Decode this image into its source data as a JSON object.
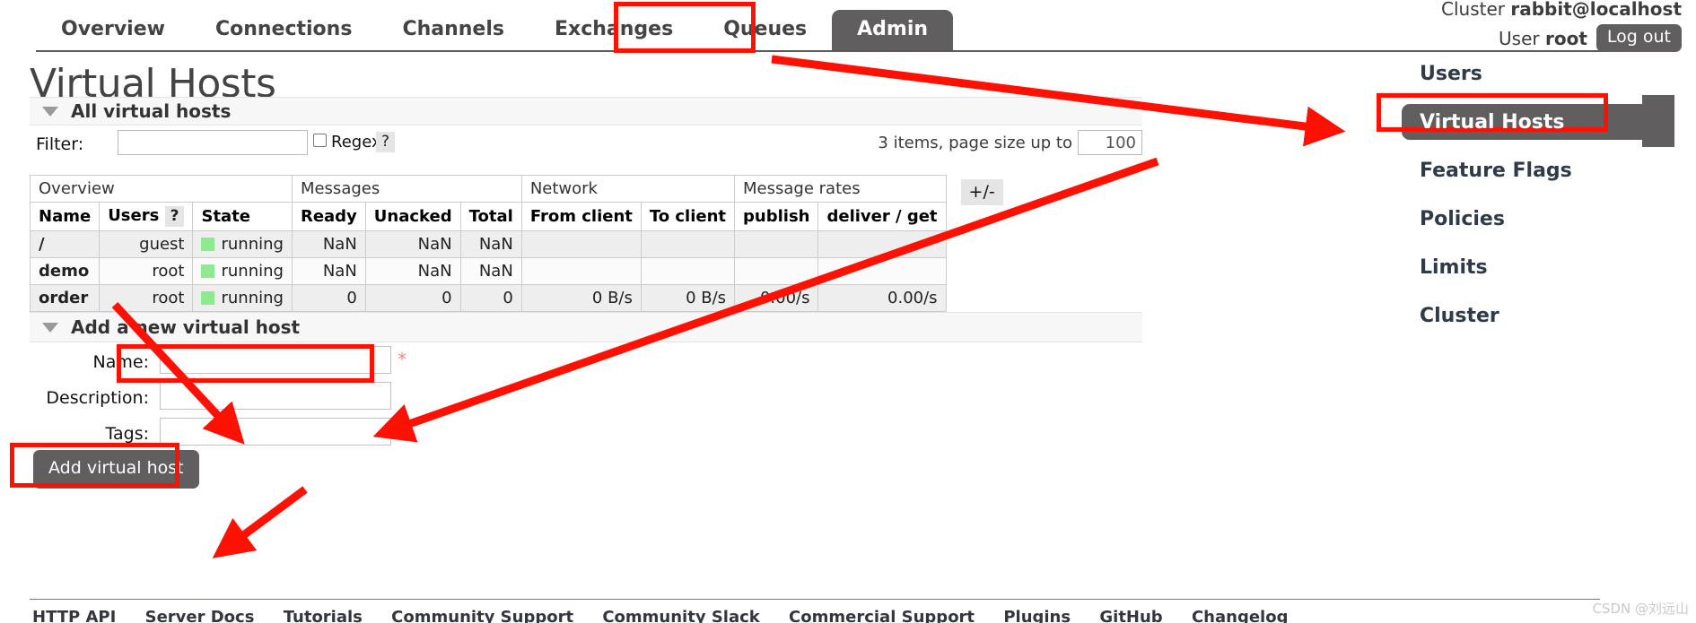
{
  "nav": {
    "tabs": [
      {
        "label": "Overview",
        "active": false
      },
      {
        "label": "Connections",
        "active": false
      },
      {
        "label": "Channels",
        "active": false
      },
      {
        "label": "Exchanges",
        "active": false
      },
      {
        "label": "Queues",
        "active": false
      },
      {
        "label": "Admin",
        "active": true
      }
    ]
  },
  "header": {
    "cluster_prefix": "Cluster ",
    "cluster_name": "rabbit@localhost",
    "user_prefix": "User ",
    "user_name": "root",
    "logout_label": "Log out"
  },
  "page": {
    "title": "Virtual Hosts"
  },
  "all_vhosts": {
    "section_label": "All virtual hosts",
    "filter_label": "Filter:",
    "filter_value": "",
    "filter_placeholder": "",
    "regex_label": "Regex",
    "regex_help": "?",
    "regex_checked": false,
    "paging_info": "3 items, page size up to",
    "page_size": "100",
    "plusminus_label": "+/-"
  },
  "table": {
    "group_headers": [
      {
        "label": "Overview",
        "colspan": 3
      },
      {
        "label": "Messages",
        "colspan": 3
      },
      {
        "label": "Network",
        "colspan": 2
      },
      {
        "label": "Message rates",
        "colspan": 2
      }
    ],
    "columns": [
      {
        "label": "Name",
        "align": "left"
      },
      {
        "label": "Users",
        "align": "left",
        "help": "?"
      },
      {
        "label": "State",
        "align": "left"
      },
      {
        "label": "Ready",
        "align": "left"
      },
      {
        "label": "Unacked",
        "align": "left"
      },
      {
        "label": "Total",
        "align": "left"
      },
      {
        "label": "From client",
        "align": "left"
      },
      {
        "label": "To client",
        "align": "left"
      },
      {
        "label": "publish",
        "align": "left"
      },
      {
        "label": "deliver / get",
        "align": "left"
      }
    ],
    "rows": [
      {
        "name": "/",
        "users": "guest",
        "state": "running",
        "ready": "NaN",
        "unacked": "NaN",
        "total": "NaN",
        "from_client": "",
        "to_client": "",
        "publish": "",
        "deliver_get": ""
      },
      {
        "name": "demo",
        "users": "root",
        "state": "running",
        "ready": "NaN",
        "unacked": "NaN",
        "total": "NaN",
        "from_client": "",
        "to_client": "",
        "publish": "",
        "deliver_get": ""
      },
      {
        "name": "order",
        "users": "root",
        "state": "running",
        "ready": "0",
        "unacked": "0",
        "total": "0",
        "from_client": "0 B/s",
        "to_client": "0 B/s",
        "publish": "0.00/s",
        "deliver_get": "0.00/s"
      }
    ]
  },
  "add_form": {
    "section_label": "Add a new virtual host",
    "name_label": "Name:",
    "name_value": "",
    "name_required_marker": "*",
    "description_label": "Description:",
    "description_value": "",
    "tags_label": "Tags:",
    "tags_value": "",
    "submit_label": "Add virtual host"
  },
  "sidebar": {
    "items": [
      {
        "label": "Users",
        "active": false
      },
      {
        "label": "Virtual Hosts",
        "active": true
      },
      {
        "label": "Feature Flags",
        "active": false
      },
      {
        "label": "Policies",
        "active": false
      },
      {
        "label": "Limits",
        "active": false
      },
      {
        "label": "Cluster",
        "active": false
      }
    ]
  },
  "footer": {
    "links": [
      "HTTP API",
      "Server Docs",
      "Tutorials",
      "Community Support",
      "Community Slack",
      "Commercial Support",
      "Plugins",
      "GitHub",
      "Changelog"
    ],
    "watermark": "CSDN @刘远山"
  },
  "colors": {
    "accent_grey": "#605e5e",
    "annotation_red": "#fc1102",
    "state_green": "#8eea8e"
  }
}
